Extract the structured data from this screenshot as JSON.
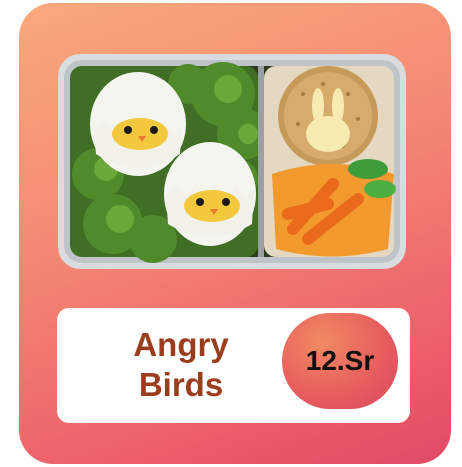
{
  "product": {
    "name_line1": "Angry",
    "name_line2": "Birds",
    "price": "12.Sr"
  },
  "colors": {
    "card_gradient_top": "#f9a97c",
    "card_gradient_bottom": "#e04a66",
    "title_text": "#9b3d1d",
    "badge_main": "#e85f5e"
  }
}
